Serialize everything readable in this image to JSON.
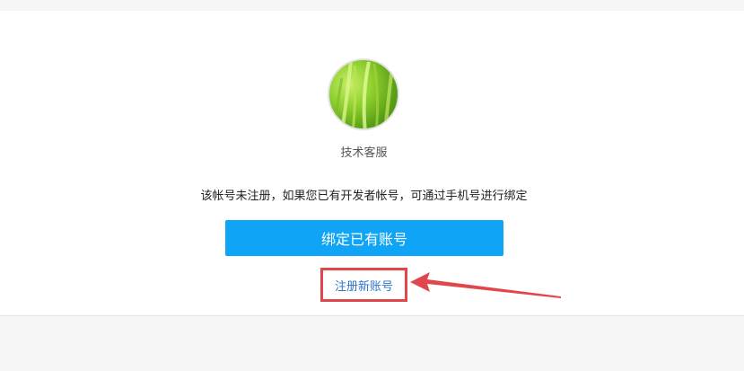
{
  "profile": {
    "name": "技术客服"
  },
  "notice_text": "该帐号未注册，如果您已有开发者帐号，可通过手机号进行绑定",
  "bind_button_label": "绑定已有账号",
  "register_link_label": "注册新账号",
  "colors": {
    "primary_button": "#10a4f7",
    "link": "#2d74c9",
    "annotation": "#e0474c"
  },
  "icons": {
    "avatar": "grass-photo",
    "annotation": "arrow-left-icon"
  }
}
